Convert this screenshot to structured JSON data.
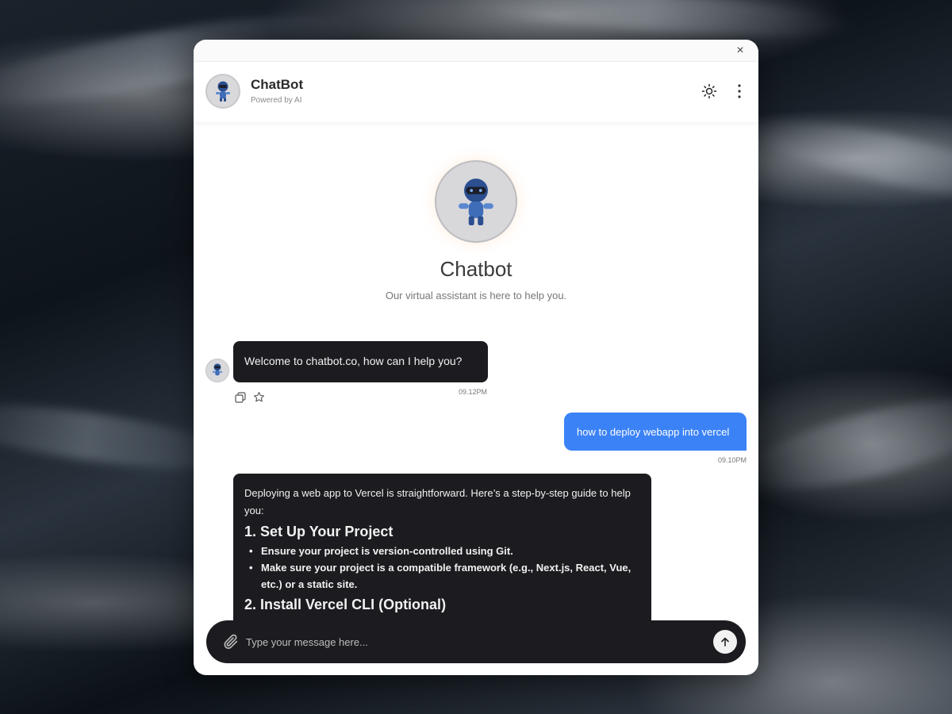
{
  "window": {
    "close_symbol": "×"
  },
  "header": {
    "title": "ChatBot",
    "subtitle": "Powered by AI",
    "avatar_icon": "robot-avatar-icon",
    "theme_icon": "sun-icon",
    "menu_icon": "more-vertical-icon"
  },
  "hero": {
    "title": "Chatbot",
    "subtitle": "Our virtual assistant is here to help you."
  },
  "messages": [
    {
      "from": "bot",
      "text": "Welcome to chatbot.co, how can I help you?",
      "time": "09.12PM"
    },
    {
      "from": "user",
      "text": "how to deploy webapp into vercel",
      "time": "09.10PM"
    },
    {
      "from": "bot",
      "intro": "Deploying a web app to Vercel is straightforward. Here’s a step-by-step guide to help you:",
      "sections": [
        {
          "heading": "1. Set Up Your Project",
          "bullets": [
            "Ensure your project is version-controlled using Git.",
            "Make sure your project is a compatible framework (e.g., Next.js, React, Vue, etc.) or a static site."
          ]
        },
        {
          "heading": "2. Install Vercel CLI (Optional)",
          "bullets": []
        }
      ]
    }
  ],
  "composer": {
    "placeholder": "Type your message here...",
    "value": ""
  },
  "colors": {
    "accent": "#3b82f6",
    "bubble_dark": "#1c1c20"
  }
}
